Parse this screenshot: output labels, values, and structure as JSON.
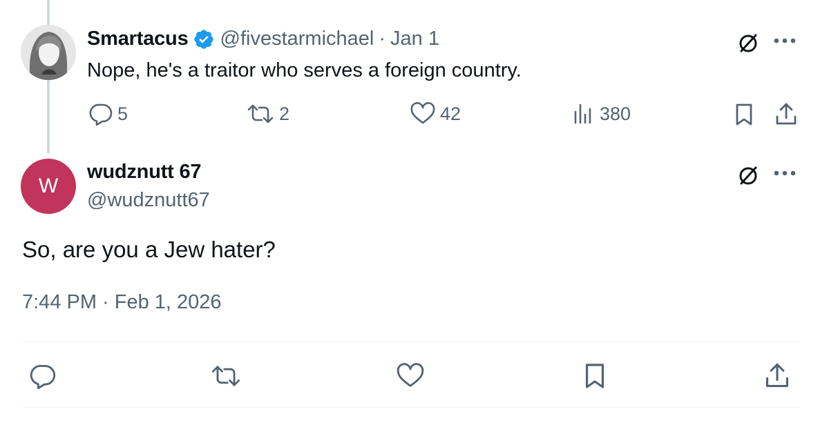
{
  "parent_tweet": {
    "display_name": "Smartacus",
    "handle": "@fivestarmichael",
    "separator": "·",
    "date": "Jan 1",
    "text": "Nope, he's a traitor who serves a foreign country.",
    "stats": {
      "replies": "5",
      "reposts": "2",
      "likes": "42",
      "views": "380"
    }
  },
  "main_tweet": {
    "avatar_letter": "W",
    "display_name": "wudznutt 67",
    "handle": "@wudznutt67",
    "text": "So, are you a Jew hater?",
    "timestamp": "7:44 PM · Feb 1, 2026"
  },
  "icons": {
    "reply": "speech-bubble-icon",
    "repost": "repost-arrows-icon",
    "like": "heart-icon",
    "views": "bar-chart-icon",
    "bookmark": "bookmark-icon",
    "share": "share-upload-icon",
    "grok": "grok-slash-circle-icon",
    "more": "more-dots-icon",
    "verified": "verified-badge-icon"
  },
  "colors": {
    "text": "#0f1419",
    "muted": "#536471",
    "verified": "#1d9bf0",
    "avatar_bg": "#c1345c",
    "divider": "#eff3f4",
    "thread_line": "#cfd9de"
  }
}
